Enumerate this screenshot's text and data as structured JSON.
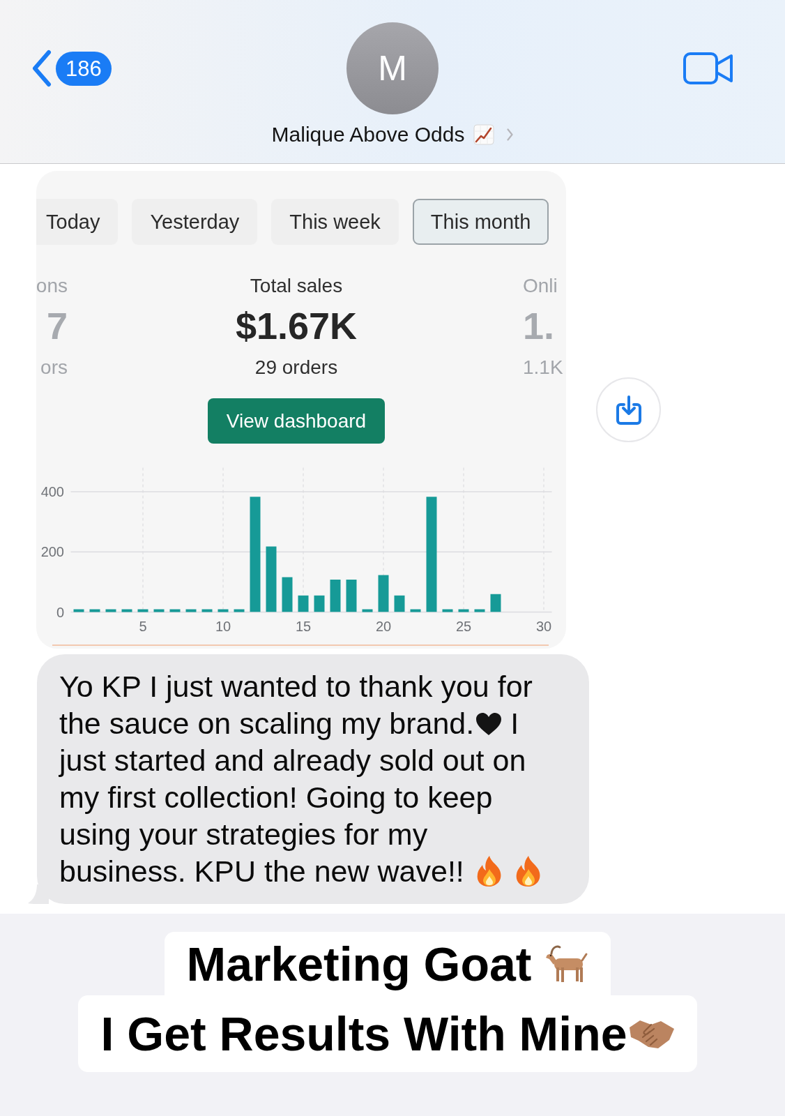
{
  "header": {
    "unread_count": "186",
    "avatar_initial": "M",
    "contact_name": "Malique Above Odds"
  },
  "shared_card": {
    "tabs": [
      {
        "label": "Today",
        "selected": false
      },
      {
        "label": "Yesterday",
        "selected": false
      },
      {
        "label": "This week",
        "selected": false
      },
      {
        "label": "This month",
        "selected": true
      }
    ],
    "metrics": [
      {
        "label": "ons",
        "value": "7",
        "subtext": "ors",
        "selected": false
      },
      {
        "label": "Total sales",
        "value": "$1.67K",
        "subtext": "29 orders",
        "selected": true
      },
      {
        "label": "Onli",
        "value": "1.",
        "subtext": "1.1K",
        "selected": false
      }
    ],
    "button": "View dashboard",
    "chart_data": {
      "type": "bar",
      "x": [
        1,
        2,
        3,
        4,
        5,
        6,
        7,
        8,
        9,
        10,
        11,
        12,
        13,
        14,
        15,
        16,
        17,
        18,
        19,
        20,
        21,
        22,
        23,
        24,
        25,
        26,
        27
      ],
      "values": [
        0,
        0,
        0,
        0,
        0,
        0,
        0,
        0,
        0,
        0,
        0,
        383,
        218,
        116,
        55,
        55,
        108,
        108,
        0,
        123,
        55,
        0,
        383,
        0,
        0,
        0,
        60
      ],
      "xlim": [
        0.5,
        30.5
      ],
      "ylim": [
        0,
        480
      ],
      "xticks": [
        5,
        10,
        15,
        20,
        25,
        30
      ],
      "yticks": [
        0,
        200,
        400
      ],
      "grid": true
    }
  },
  "message": {
    "segments": [
      {
        "kind": "text",
        "text": "Yo KP I just wanted to thank you for the sauce on scaling my brand."
      },
      {
        "kind": "heart"
      },
      {
        "kind": "text",
        "text": " I just started and already sold out on my first collection! Going to keep using your strategies for my business. KPU the new wave!!"
      },
      {
        "kind": "fire"
      },
      {
        "kind": "fire"
      }
    ]
  },
  "caption": {
    "lines": [
      {
        "segments": [
          {
            "kind": "text",
            "text": "Marketing Goat"
          },
          {
            "kind": "goat"
          }
        ]
      },
      {
        "segments": [
          {
            "kind": "text",
            "text": "I Get Results With Mine"
          },
          {
            "kind": "handshake"
          }
        ]
      }
    ]
  }
}
